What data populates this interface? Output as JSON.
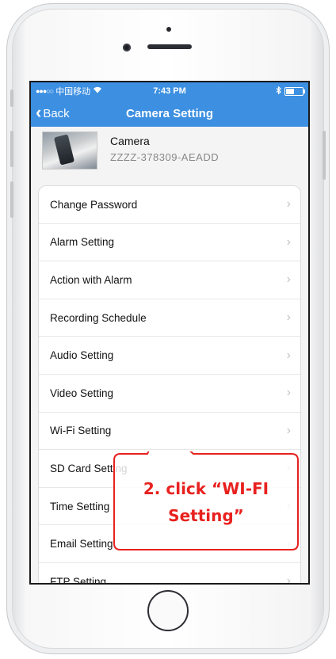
{
  "status_bar": {
    "carrier": "中国移动",
    "time": "7:43 PM"
  },
  "nav": {
    "back_label": "Back",
    "title": "Camera Setting"
  },
  "camera": {
    "name": "Camera",
    "id": "ZZZZ-378309-AEADD"
  },
  "settings": [
    {
      "label": "Change Password"
    },
    {
      "label": "Alarm Setting"
    },
    {
      "label": "Action with Alarm"
    },
    {
      "label": "Recording Schedule"
    },
    {
      "label": "Audio Setting"
    },
    {
      "label": "Video Setting"
    },
    {
      "label": "Wi-Fi Setting"
    },
    {
      "label": "SD Card Setting"
    },
    {
      "label": "Time Setting"
    },
    {
      "label": "Email Setting"
    },
    {
      "label": "FTP Setting"
    }
  ],
  "callout": {
    "line1": "2. click “WI-FI",
    "line2": "Setting”"
  },
  "colors": {
    "nav_blue": "#3c8fe1",
    "callout_red": "#e8211f"
  }
}
